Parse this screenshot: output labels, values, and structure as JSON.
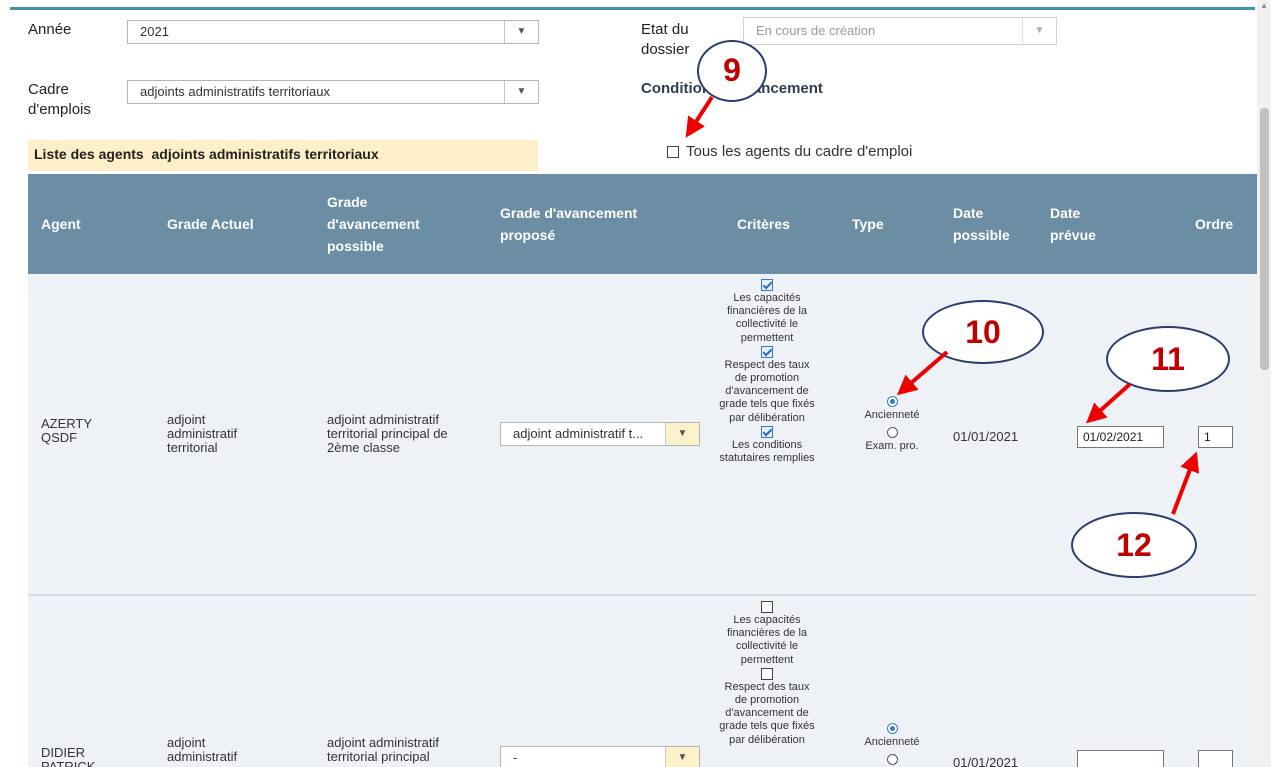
{
  "form": {
    "annee_label": "Année",
    "annee_value": "2021",
    "etat_label": "Etat du dossier",
    "etat_value": "En cours de création",
    "cadre_label": "Cadre d'emplois",
    "cadre_value": "adjoints administratifs territoriaux",
    "conditions_title": "Conditions d'avancement",
    "liste_label": "Liste des agents",
    "liste_value": "adjoints administratifs territoriaux",
    "tous_agents_label": "Tous les agents du cadre d'emploi"
  },
  "table": {
    "headers": {
      "agent": "Agent",
      "grade_actuel": "Grade Actuel",
      "grade_possible": "Grade d'avancement possible",
      "grade_propose": "Grade d'avancement proposé",
      "criteres": "Critères",
      "type": "Type",
      "date_possible": "Date possible",
      "date_prevue": "Date prévue",
      "ordre": "Ordre"
    },
    "criteria_labels": [
      "Les capacités financières de la collectivité le permettent",
      "Respect des taux de promotion d'avancement de grade tels que fixés par délibération",
      "Les conditions statutaires remplies"
    ],
    "type_options": [
      "Ancienneté",
      "Exam. pro."
    ],
    "rows": [
      {
        "agent": "AZERTY QSDF",
        "grade_actuel": "adjoint administratif territorial",
        "grade_possible": "adjoint administratif territorial principal de 2ème classe",
        "grade_propose": "adjoint administratif t...",
        "criteria_checked": [
          true,
          true,
          true
        ],
        "type_selected": "Ancienneté",
        "date_possible": "01/01/2021",
        "date_prevue": "01/02/2021",
        "ordre": "1"
      },
      {
        "agent": "DIDIER PATRICK",
        "grade_actuel": "adjoint administratif",
        "grade_possible": "adjoint administratif territorial principal",
        "grade_propose": "-",
        "criteria_checked": [
          false,
          false
        ],
        "type_selected": "Ancienneté",
        "date_possible": "01/01/2021",
        "date_prevue": "",
        "ordre": ""
      }
    ]
  },
  "callouts": {
    "c9": "9",
    "c10": "10",
    "c11": "11",
    "c12": "12"
  },
  "colors": {
    "header_bg": "#6b8ea5",
    "row_bg": "#eef2f7",
    "banner_bg": "#fdf0c8",
    "callout_text": "#c00000",
    "callout_border": "#2b3e72",
    "arrow": "#ee0000"
  }
}
